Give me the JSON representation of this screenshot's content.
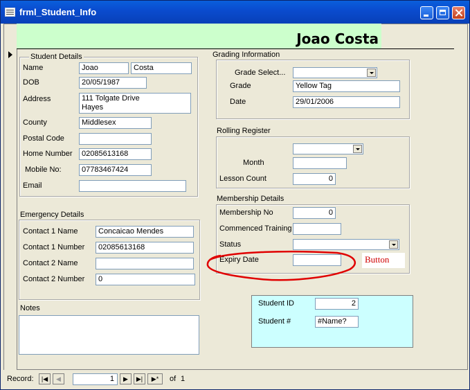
{
  "window": {
    "title": "frml_Student_Info"
  },
  "header": {
    "student_name": "Joao Costa"
  },
  "student_details": {
    "title": "Student Details",
    "name_label": "Name",
    "first_name": "Joao",
    "last_name": "Costa",
    "dob_label": "DOB",
    "dob": "20/05/1987",
    "address_label": "Address",
    "address": "111 Tolgate Drive\nHayes",
    "county_label": "County",
    "county": "Middlesex",
    "postal_label": "Postal Code",
    "postal": "",
    "home_label": "Home Number",
    "home": "02085613168",
    "mobile_label": "Mobile No:",
    "mobile": "07783467424",
    "email_label": "Email",
    "email": ""
  },
  "emergency_details": {
    "title": "Emergency Details",
    "c1_name_label": "Contact 1 Name",
    "c1_name": "Concaicao Mendes",
    "c1_num_label": "Contact 1 Number",
    "c1_num": "02085613168",
    "c2_name_label": "Contact 2 Name",
    "c2_name": "",
    "c2_num_label": "Contact 2 Number",
    "c2_num": "0"
  },
  "notes": {
    "label": "Notes",
    "value": ""
  },
  "grading": {
    "title": "Grading Information",
    "select_label": "Grade Select...",
    "select_value": "",
    "grade_label": "Grade",
    "grade": "Yellow Tag",
    "date_label": "Date",
    "date": "29/01/2006"
  },
  "rolling": {
    "title": "Rolling Register",
    "select_value": "",
    "month_label": "Month",
    "month": "",
    "lesson_label": "Lesson Count",
    "lesson": "0"
  },
  "membership": {
    "title": "Membership Details",
    "no_label": "Membership No",
    "no": "0",
    "commenced_label": "Commenced Training",
    "commenced": "",
    "status_label": "Status",
    "status": "",
    "expiry_label": "Expiry Date",
    "expiry": "",
    "button_text": "Button"
  },
  "ids": {
    "student_id_label": "Student ID",
    "student_id": "2",
    "student_num_label": "Student #",
    "student_num": "#Name?"
  },
  "record_nav": {
    "label": "Record:",
    "current": "1",
    "of_label": "of",
    "total": "1"
  },
  "colors": {
    "header_bg": "#ccffcc",
    "id_panel_bg": "#ccffff",
    "annotation": "#d00000"
  }
}
